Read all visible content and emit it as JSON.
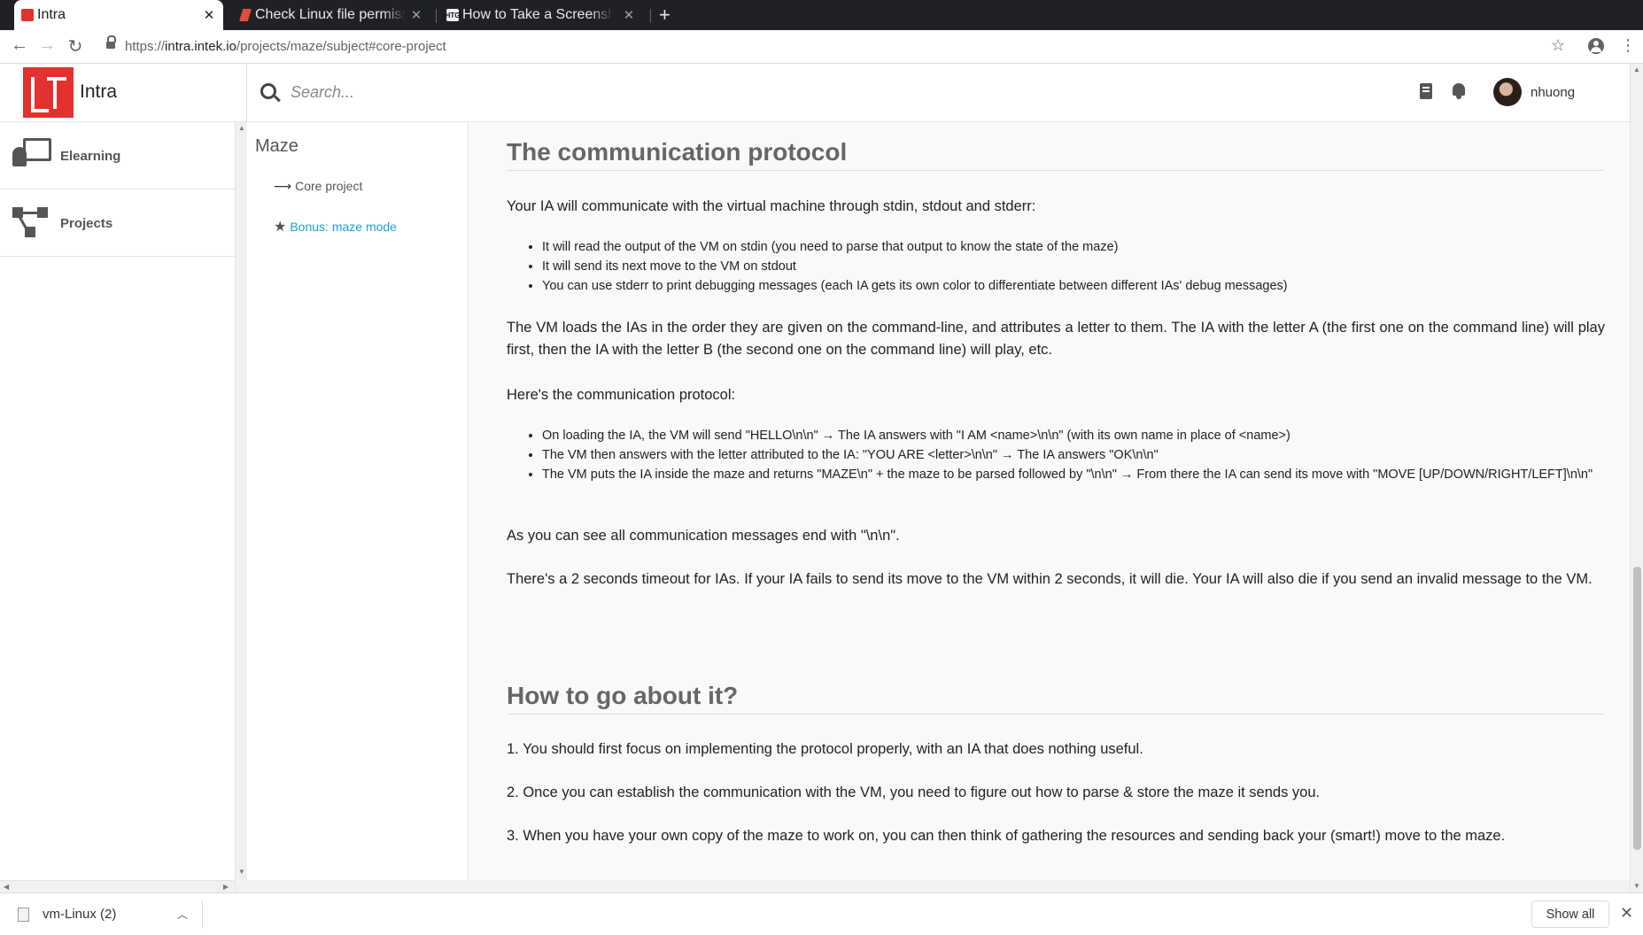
{
  "browser": {
    "tabs": [
      {
        "title": "Intra",
        "favicon": "intra-logo-icon"
      },
      {
        "title": "Check Linux file permissions",
        "favicon": "linux-site-icon"
      },
      {
        "title": "How to Take a Screenshot",
        "favicon": "htg-site-icon"
      }
    ],
    "url_scheme": "https://",
    "url_host": "intra.intek.io",
    "url_path": "/projects/maze/subject#core-project"
  },
  "header": {
    "brand": "Intra",
    "search_placeholder": "Search...",
    "username": "nhuong"
  },
  "sidebar": {
    "items": [
      {
        "label": "Elearning",
        "icon": "elearning-icon"
      },
      {
        "label": "Projects",
        "icon": "projects-icon"
      }
    ]
  },
  "subnav": {
    "title": "Maze",
    "links": [
      {
        "label": "Core project",
        "icon": "arrow-right-icon",
        "color": "#555555"
      },
      {
        "label": "Bonus: maze mode",
        "icon": "star-icon",
        "color": "#1a9fd6"
      }
    ]
  },
  "content": {
    "section1_title": "The communication protocol",
    "p1": "Your IA will communicate with the virtual machine through stdin, stdout and stderr:",
    "list1": [
      "It will read the output of the VM on stdin (you need to parse that output to know the state of the maze)",
      "It will send its next move to the VM on stdout",
      "You can use stderr to print debugging messages (each IA gets its own color to differentiate between different IAs' debug messages)"
    ],
    "p2": "The VM loads the IAs in the order they are given on the command-line, and attributes a letter to them. The IA with the letter A (the first one on the command line) will play first, then the IA with the letter B (the second one on the command line) will play, etc.",
    "p3": "Here's the communication protocol:",
    "list2": [
      "On loading the IA, the VM will send \"HELLO\\n\\n\" → The IA answers with \"I AM <name>\\n\\n\" (with its own name in place of <name>)",
      "The VM then answers with the letter attributed to the IA: \"YOU ARE <letter>\\n\\n\" → The IA answers \"OK\\n\\n\"",
      "The VM puts the IA inside the maze and returns \"MAZE\\n\" + the maze to be parsed followed by \"\\n\\n\" → From there the IA can send its move with \"MOVE [UP/DOWN/RIGHT/LEFT]\\n\\n\""
    ],
    "p4": "As you can see all communication messages end with \"\\n\\n\".",
    "p5": "There's a 2 seconds timeout for IAs. If your IA fails to send its move to the VM within 2 seconds, it will die. Your IA will also die if you send an invalid message to the VM.",
    "section2_title": "How to go about it?",
    "steps": [
      "1. You should first focus on implementing the protocol properly, with an IA that does nothing useful.",
      "2. Once you can establish the communication with the VM, you need to figure out how to parse & store the maze it sends you.",
      "3. When you have your own copy of the maze to work on, you can then think of gathering the resources and sending back your (smart!) move to the maze."
    ]
  },
  "downloads": {
    "file_name": "vm-Linux (2)",
    "show_all_label": "Show all"
  },
  "colors": {
    "brand_red": "#e2312f",
    "link_blue": "#1a9fd6",
    "tabstrip": "#202124"
  }
}
